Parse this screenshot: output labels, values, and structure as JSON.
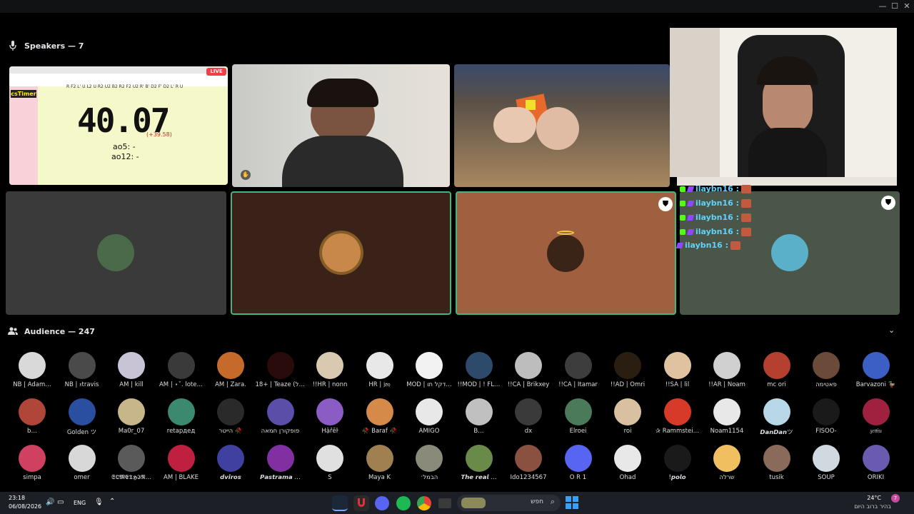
{
  "speakers": {
    "label": "Speakers — 7"
  },
  "audience": {
    "label": "Audience — 247"
  },
  "cstimer": {
    "title": "csTimer",
    "time": "40.07",
    "delta": "(+39.58)",
    "ao5": "ao5: -",
    "ao12": "ao12: -",
    "scramble": "R F2 L' U L2 U R2 U2 B2 R2 F2 U2 R' B' D2 F' D2 L' R U",
    "live": "LIVE"
  },
  "chat": {
    "user": "ilaybn16 :"
  },
  "audience_members": [
    {
      "name": "NB | Adam…",
      "color": "#d9d9d9"
    },
    {
      "name": "NB | 𝔵travis",
      "color": "#4a4a4a"
    },
    {
      "name": "AM | kill",
      "color": "#c9c3d6"
    },
    {
      "name": "AM | ⋆˚. lote…",
      "color": "#3a3a3a"
    },
    {
      "name": "AM | Zara.",
      "color": "#c56a2a"
    },
    {
      "name": "18+ | Teaze (יל…",
      "color": "#2a0b0b"
    },
    {
      "name": "!!HR | nonn",
      "color": "#d8c9b0"
    },
    {
      "name": "HR | 𝔧𝔬𝔶",
      "color": "#e8e8e8"
    },
    {
      "name": "MOD | דקל תו…",
      "color": "#f2f2f2"
    },
    {
      "name": "!!MOD | ! FL…",
      "color": "#2e4a6b"
    },
    {
      "name": "!!CA | Brikxey",
      "color": "#bdbdbd"
    },
    {
      "name": "!!CA | Itamar",
      "color": "#3d3d3d"
    },
    {
      "name": "!!AD | Omri",
      "color": "#2a1d12"
    },
    {
      "name": "!!SA | lil",
      "color": "#e0c2a0"
    },
    {
      "name": "!!AR | Noam",
      "color": "#d0d0d0"
    },
    {
      "name": "mc ori",
      "color": "#b5402f"
    },
    {
      "name": "פאטימה",
      "color": "#6b4a3a"
    },
    {
      "name": "Barvazoni 🦆",
      "color": "#3b5fc4"
    },
    {
      "name": "b…",
      "color": "#b0453a"
    },
    {
      "name": "Golden ツ",
      "color": "#2b4fa0"
    },
    {
      "name": "Ma0r_07",
      "color": "#c7b68a"
    },
    {
      "name": "retардед",
      "color": "#3b8a70"
    },
    {
      "name": "הייטר 🥀",
      "color": "#2a2a2a"
    },
    {
      "name": "פופקורן חמאה",
      "color": "#5a4ea8"
    },
    {
      "name": "Ĥậřēŀ",
      "color": "#8a5cc4"
    },
    {
      "name": "🥀 Baraf 🥀",
      "color": "#d68a4a"
    },
    {
      "name": "AMIGO",
      "color": "#e8e8e8"
    },
    {
      "name": "B…",
      "color": "#c0c0c0"
    },
    {
      "name": "dx",
      "color": "#3a3a3a"
    },
    {
      "name": "Elroei",
      "color": "#4a7a5a"
    },
    {
      "name": "roi",
      "color": "#d8c0a0"
    },
    {
      "name": "✰ Rammstei…",
      "color": "#d83a2a"
    },
    {
      "name": "Noam1154",
      "color": "#e8e8e8"
    },
    {
      "name": "𝘿𝙖𝙣𝘿𝙖𝙣ツ",
      "color": "#b8d8e8"
    },
    {
      "name": "FISOO-",
      "color": "#1a1a1a"
    },
    {
      "name": "𝔷𝔢𝔫𝔦𝔲",
      "color": "#a02040"
    },
    {
      "name": "simpa",
      "color": "#d04060"
    },
    {
      "name": "omer",
      "color": "#d8d8d8"
    },
    {
      "name": "𝕾𝕺𝕸𝕰𝕿𝕳𝕴𝕹…",
      "color": "#5a5a5a"
    },
    {
      "name": "AM | BLAKE",
      "color": "#c02040"
    },
    {
      "name": "𝙙𝙫𝙞𝙧𝙤𝙨",
      "color": "#4040a0"
    },
    {
      "name": "𝙋𝙖𝙨𝙩𝙧𝙖𝙢𝙖 …",
      "color": "#8030a0"
    },
    {
      "name": "S",
      "color": "#e0e0e0"
    },
    {
      "name": "Maya K",
      "color": "#a08050"
    },
    {
      "name": "הבמל׳",
      "color": "#8a8a7a"
    },
    {
      "name": "𝙏𝙝𝙚 𝙧𝙚𝙖𝙡 …",
      "color": "#6a8a4a"
    },
    {
      "name": "Ido1234567",
      "color": "#8a5040"
    },
    {
      "name": "O R 1",
      "color": "#5865f2"
    },
    {
      "name": "Ohad",
      "color": "#e8e8e8"
    },
    {
      "name": "!𝙥𝙤𝙡𝙤",
      "color": "#1a1a1a"
    },
    {
      "name": "שרלה",
      "color": "#f0c060"
    },
    {
      "name": "tusik",
      "color": "#8a6a5a"
    },
    {
      "name": "SOUP",
      "color": "#d0d8e0"
    },
    {
      "name": "ORIKI",
      "color": "#6a5ab0"
    }
  ],
  "taskbar": {
    "time": "23:18",
    "date": "06/08/2026",
    "lang": "ENG",
    "search_placeholder": "חפש",
    "weather_temp": "24°C",
    "weather_desc": "בהיר ברוב היום",
    "notif_count": "7"
  },
  "colors": {
    "accent_green": "#43b581",
    "tile_brown": "#3b2218",
    "tile_orange": "#a0603f",
    "tile_green": "#4a5647",
    "tile_gray": "#3a3a3a"
  }
}
